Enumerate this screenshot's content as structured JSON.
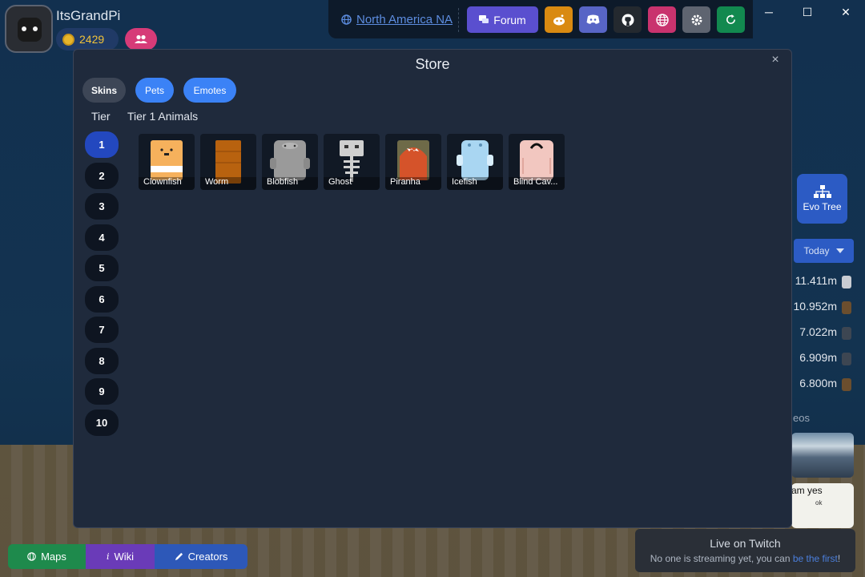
{
  "profile": {
    "username": "ItsGrandPi",
    "coins": "2429",
    "avatar_icon": "cat-avatar-icon",
    "friends_icon": "friends-icon"
  },
  "topbar": {
    "server": "North America NA",
    "forum_label": "Forum",
    "icons": [
      "globe-icon",
      "forum-icon",
      "reddit-icon",
      "discord-icon",
      "github-icon",
      "language-icon",
      "gear-icon",
      "refresh-icon"
    ],
    "colors": {
      "forum": "#5a4fcf",
      "reddit": "#d98a11",
      "discord": "#5865c6",
      "github": "#24292f",
      "language": "#c9336e",
      "settings": "#5e6470",
      "refresh": "#12894f"
    }
  },
  "window_controls": {
    "minimize": "─",
    "maximize": "☐",
    "close": "✕"
  },
  "store": {
    "title": "Store",
    "close": "×",
    "tabs": [
      {
        "label": "Skins",
        "active": true
      },
      {
        "label": "Pets",
        "active": false
      },
      {
        "label": "Emotes",
        "active": false
      }
    ],
    "tier_label": "Tier",
    "tier_heading": "Tier 1 Animals",
    "tiers": [
      "1",
      "2",
      "3",
      "4",
      "5",
      "6",
      "7",
      "8",
      "9",
      "10"
    ],
    "selected_tier": "1",
    "animals": [
      {
        "name": "Clownfish",
        "color": "#f6b15c"
      },
      {
        "name": "Worm",
        "color": "#b8620f"
      },
      {
        "name": "Blobfish",
        "color": "#9a9a9a"
      },
      {
        "name": "Ghost",
        "color": "#cfcfcf"
      },
      {
        "name": "Piranha",
        "color": "#d5532a"
      },
      {
        "name": "Icefish",
        "color": "#a9d6f2"
      },
      {
        "name": "Blind Cav...",
        "color": "#f2c7c0"
      }
    ]
  },
  "side": {
    "evo_tree": "Evo Tree",
    "today": "Today",
    "leaderboard": [
      "11.411m",
      "10.952m",
      "7.022m",
      "6.909m",
      "6.800m"
    ],
    "videos_label": "eos",
    "video2_text": "am yes",
    "video2_sub": "ok"
  },
  "twitch": {
    "title": "Live on Twitch",
    "sub": "No one is streaming yet, you can ",
    "link": "be the first",
    "end": "!"
  },
  "bottom_links": {
    "maps": "Maps",
    "wiki": "Wiki",
    "creators": "Creators"
  }
}
